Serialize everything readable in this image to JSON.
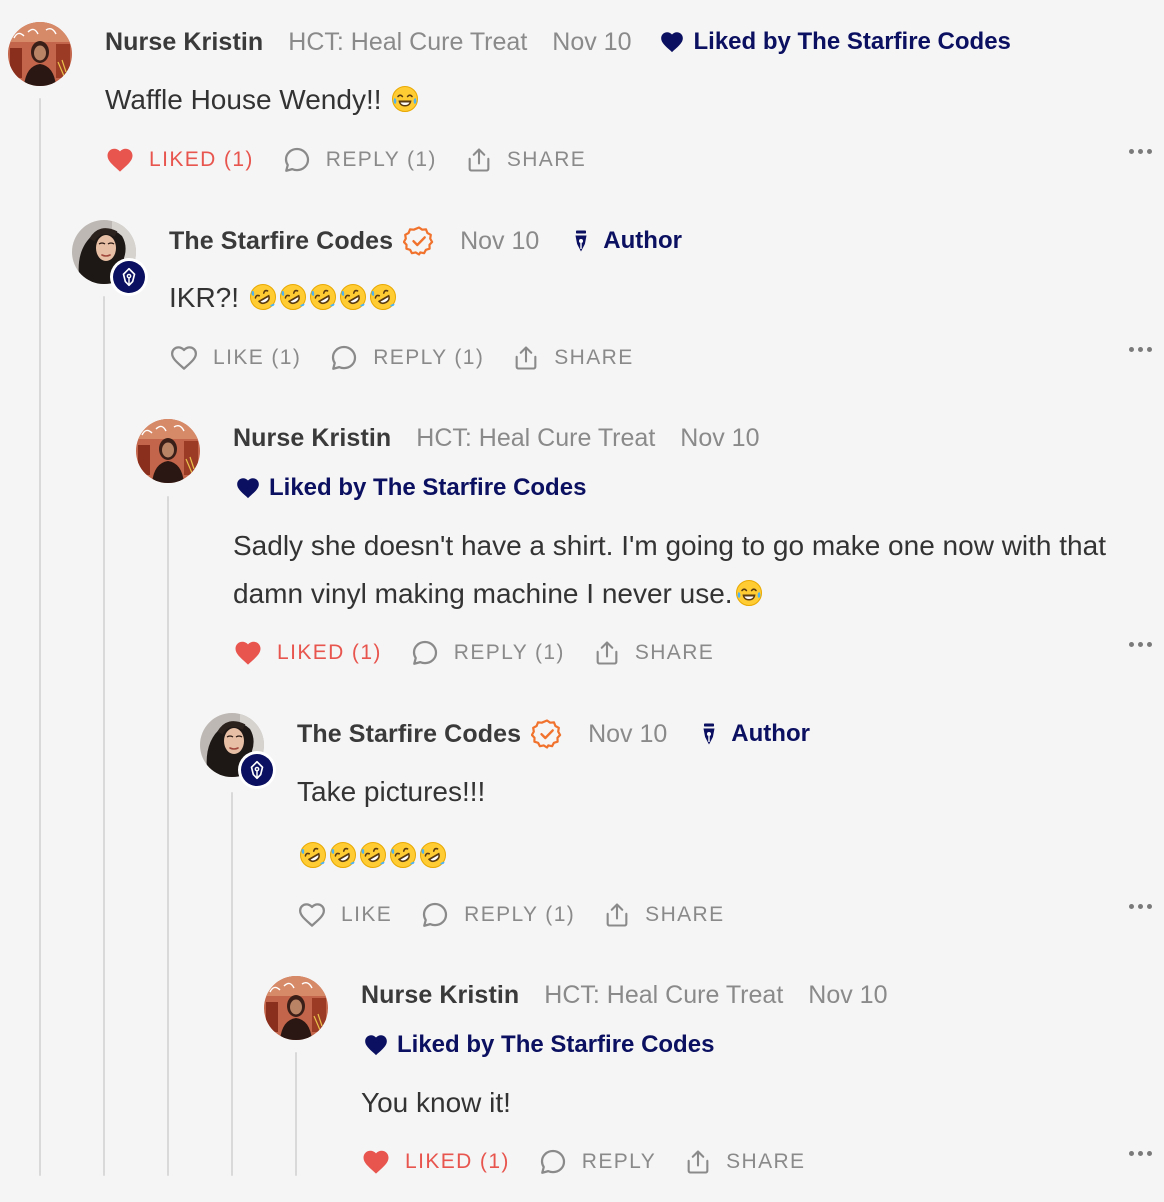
{
  "colors": {
    "background": "#f5f5f5",
    "accent_navy": "#0b1060",
    "liked_red": "#e8554e",
    "verified_orange": "#f0722c",
    "muted_text": "#8a8a8a",
    "thread_line": "#d9d9d9"
  },
  "comments": [
    {
      "name": "Nurse Kristin",
      "publication": "HCT: Heal Cure Treat",
      "date": "Nov 10",
      "liked_by": "Liked by The Starfire Codes",
      "text": "Waffle House Wendy!!",
      "emoji": "face-with-tears-of-joy",
      "actions": {
        "like": "LIKED (1)",
        "reply": "REPLY (1)",
        "share": "SHARE"
      }
    },
    {
      "name": "The Starfire Codes",
      "date": "Nov 10",
      "author_tag": "Author",
      "text": "IKR?!",
      "emoji": "rolling-on-floor-laughing x5",
      "actions": {
        "like": "LIKE (1)",
        "reply": "REPLY (1)",
        "share": "SHARE"
      }
    },
    {
      "name": "Nurse Kristin",
      "publication": "HCT: Heal Cure Treat",
      "date": "Nov 10",
      "liked_by": "Liked by The Starfire Codes",
      "text": "Sadly she doesn't have a shirt. I'm going to go make one now with that damn vinyl making machine I never use.",
      "emoji": "face-with-tears-of-joy",
      "actions": {
        "like": "LIKED (1)",
        "reply": "REPLY (1)",
        "share": "SHARE"
      }
    },
    {
      "name": "The Starfire Codes",
      "date": "Nov 10",
      "author_tag": "Author",
      "text": "Take pictures!!!",
      "emoji": "rolling-on-floor-laughing x5",
      "actions": {
        "like": "LIKE",
        "reply": "REPLY (1)",
        "share": "SHARE"
      }
    },
    {
      "name": "Nurse Kristin",
      "publication": "HCT: Heal Cure Treat",
      "date": "Nov 10",
      "liked_by": "Liked by The Starfire Codes",
      "text": "You know it!",
      "actions": {
        "like": "LIKED (1)",
        "reply": "REPLY",
        "share": "SHARE"
      }
    }
  ]
}
